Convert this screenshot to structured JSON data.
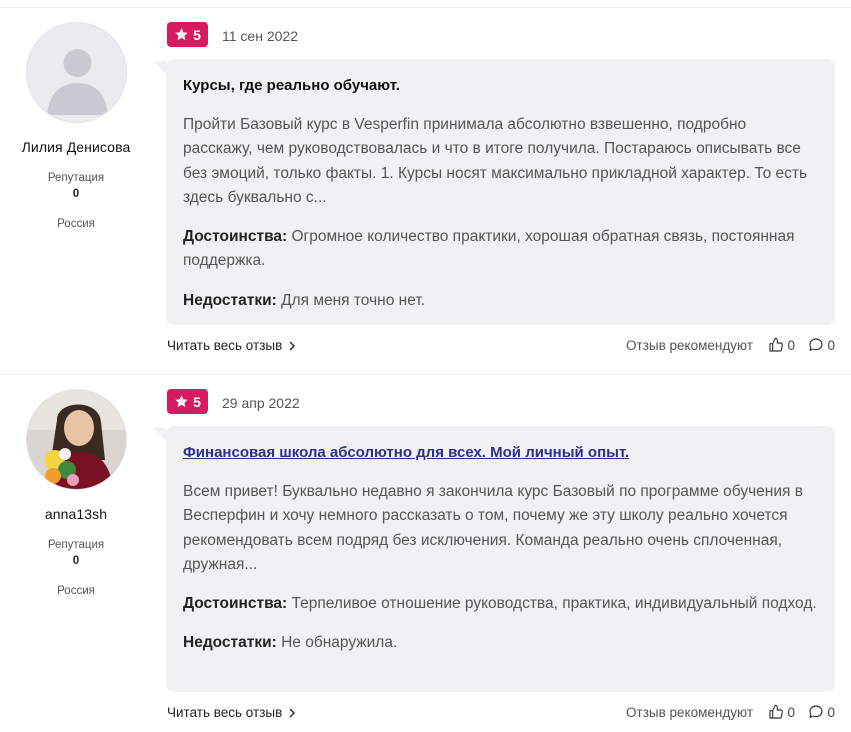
{
  "reviews": [
    {
      "author": {
        "name": "Лилия Денисова",
        "reputation_label": "Репутация",
        "reputation": "0",
        "country": "Россия",
        "avatar": "default-avatar-icon"
      },
      "rating": "5",
      "date": "11 сен 2022",
      "title": "Курсы, где реально обучают.",
      "title_is_link": false,
      "text": "Пройти Базовый курс в Vesperfin принимала абсолютно взвешенно, подробно расскажу, чем руководствовалась и что в итоге получила. Постараюсь описывать все без эмоций, только факты. 1. Курсы носят максимально прикладной характер. То есть здесь буквально с...",
      "pros_label": "Достоинства:",
      "pros": "Огромное количество практики, хорошая обратная связь, постоянная поддержка.",
      "cons_label": "Недостатки:",
      "cons": "Для меня точно нет.",
      "read_more": "Читать весь отзыв",
      "recommend_label": "Отзыв рекомендуют",
      "likes": "0",
      "comments": "0"
    },
    {
      "author": {
        "name": "anna13sh",
        "reputation_label": "Репутация",
        "reputation": "0",
        "country": "Россия",
        "avatar": "user-photo-avatar"
      },
      "rating": "5",
      "date": "29 апр 2022",
      "title": "Финансовая школа абсолютно для всех. Мой личный опыт.",
      "title_is_link": true,
      "text": "Всем привет! Буквально недавно я закончила курс Базовый по программе обучения в Весперфин и хочу немного рассказать о том, почему же эту школу реально хочется рекомендовать всем подряд без исключения. Команда реально очень сплоченная, дружная...",
      "pros_label": "Достоинства:",
      "pros": "Терпеливое отношение руководства, практика, индивидуальный подход.",
      "cons_label": "Недостатки:",
      "cons": "Не обнаружила.",
      "read_more": "Читать весь отзыв",
      "recommend_label": "Отзыв рекомендуют",
      "likes": "0",
      "comments": "0"
    }
  ],
  "colors": {
    "rating_badge": "#d81b60",
    "bubble_bg": "#f1f1f4",
    "link": "#2b2f8f"
  }
}
